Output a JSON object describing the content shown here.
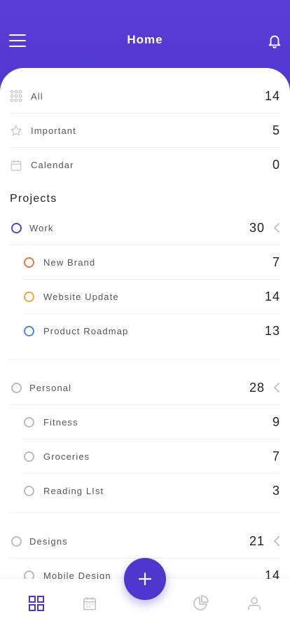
{
  "header": {
    "title": "Home"
  },
  "filters": [
    {
      "label": "All",
      "count": "14"
    },
    {
      "label": "Important",
      "count": "5"
    },
    {
      "label": "Calendar",
      "count": "0"
    }
  ],
  "projects_title": "Projects",
  "projects": [
    {
      "label": "Work",
      "count": "30",
      "color": "#5a3fd6",
      "items": [
        {
          "label": "New Brand",
          "count": "7",
          "color": "#e07a3f"
        },
        {
          "label": "Website Update",
          "count": "14",
          "color": "#f0a63a"
        },
        {
          "label": "Product Roadmap",
          "count": "13",
          "color": "#4a86e0"
        }
      ]
    },
    {
      "label": "Personal",
      "count": "28",
      "color": "#bbbbbb",
      "items": [
        {
          "label": "Fitness",
          "count": "9",
          "color": "#bbbbbb"
        },
        {
          "label": "Groceries",
          "count": "7",
          "color": "#bbbbbb"
        },
        {
          "label": "Reading LIst",
          "count": "3",
          "color": "#bbbbbb"
        }
      ]
    },
    {
      "label": "Designs",
      "count": "21",
      "color": "#bbbbbb",
      "items": [
        {
          "label": "Mobile Design",
          "count": "14",
          "color": "#bbbbbb"
        }
      ]
    }
  ],
  "tabs": [
    "grid-icon",
    "calendar-icon",
    "add-icon",
    "pie-chart-icon",
    "profile-icon"
  ],
  "colors": {
    "accent": "#4f36cc",
    "tab_active": "#4f36cc",
    "tab_inactive": "#c4c4c4"
  }
}
